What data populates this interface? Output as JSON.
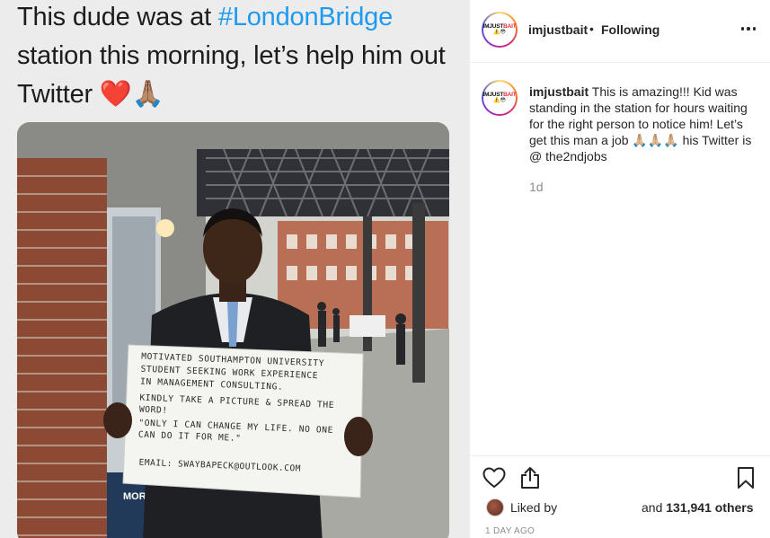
{
  "tweet": {
    "text_before": "This dude was at ",
    "hashtag": "#LondonBridge",
    "text_after": " station this morning, let’s help him out Twitter ",
    "emojis": "❤️🙏🏽"
  },
  "sign": {
    "lines": [
      "MOTIVATED SOUTHAMPTON UNIVERSITY",
      "STUDENT  SEEKING  WORK EXPERIENCE",
      "IN MANAGEMENT CONSULTING.",
      "KINDLY TAKE A PICTURE & SPREAD THE",
      "WORD!",
      "\"ONLY I CAN CHANGE MY LIFE. NO ONE",
      "CAN DO IT FOR ME.\""
    ],
    "email": "EMAIL: SWAYBAPECK@OUTLOOK.COM"
  },
  "poster_text": "MORNI TALK",
  "header": {
    "avatar_logo": "IMJUSTBAIT",
    "avatar_logo_part1": "IMJUST",
    "avatar_logo_part2": "BAIT",
    "avatar_emoji": "⚠️😳",
    "username": "imjustbait",
    "separator": "•",
    "follow_status": "Following",
    "more_icon": "more-horizontal-icon"
  },
  "caption": {
    "username": "imjustbait",
    "text": " This is amazing!!! Kid was standing in the station for hours waiting for the right person to notice him! Let’s get this man a job 🙏🏼🙏🏼🙏🏼 his Twitter is @ the2ndjobs",
    "time": "1d"
  },
  "actions": {
    "like_icon": "heart-icon",
    "share_icon": "share-icon",
    "save_icon": "bookmark-icon"
  },
  "likes": {
    "liked_by_label": "Liked by",
    "and_label": "and ",
    "count": "131,941 others"
  },
  "timestamp": "1 DAY AGO",
  "colors": {
    "hashtag": "#1d9bf0",
    "secondary_text": "#8e8e8e",
    "primary_text": "#262626",
    "border": "#efefef"
  }
}
